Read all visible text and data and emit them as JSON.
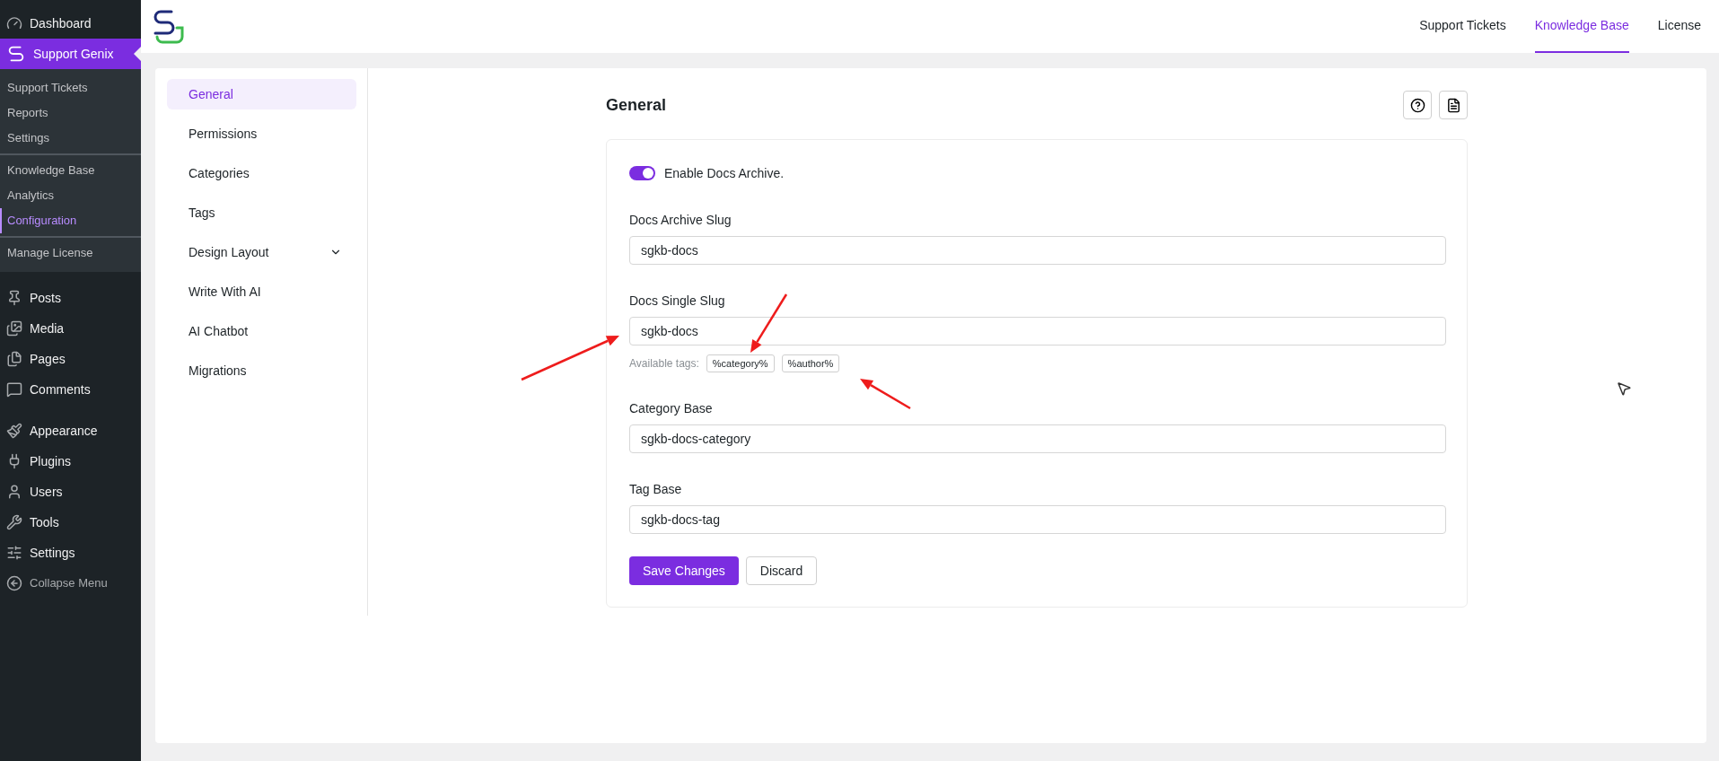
{
  "admin_menu": {
    "sections": [
      {
        "items": [
          {
            "label": "Dashboard",
            "selected": false
          },
          {
            "label": "Support Genix",
            "selected": true,
            "groups": [
              {
                "items": [
                  {
                    "label": "Support Tickets",
                    "selected": false
                  },
                  {
                    "label": "Reports",
                    "selected": false
                  },
                  {
                    "label": "Settings",
                    "selected": false
                  }
                ]
              },
              {
                "items": [
                  {
                    "label": "Knowledge Base",
                    "selected": false
                  },
                  {
                    "label": "Analytics",
                    "selected": false
                  },
                  {
                    "label": "Configuration",
                    "selected": true
                  }
                ]
              },
              {
                "items": [
                  {
                    "label": "Manage License",
                    "selected": false
                  }
                ]
              }
            ]
          }
        ]
      },
      {
        "items": [
          {
            "label": "Posts",
            "selected": false
          },
          {
            "label": "Media",
            "selected": false
          },
          {
            "label": "Pages",
            "selected": false
          },
          {
            "label": "Comments",
            "selected": false
          }
        ]
      },
      {
        "items": [
          {
            "label": "Appearance",
            "selected": false
          },
          {
            "label": "Plugins",
            "selected": false
          },
          {
            "label": "Users",
            "selected": false
          },
          {
            "label": "Tools",
            "selected": false
          },
          {
            "label": "Settings",
            "selected": false
          }
        ]
      }
    ],
    "collapse": "Collapse Menu"
  },
  "top_nav": [
    {
      "label": "Support Tickets",
      "selected": false
    },
    {
      "label": "Knowledge Base",
      "selected": true
    },
    {
      "label": "License",
      "selected": false
    }
  ],
  "settings_nav": [
    {
      "label": "General",
      "selected": true,
      "expandable": false
    },
    {
      "label": "Permissions",
      "selected": false,
      "expandable": false
    },
    {
      "label": "Categories",
      "selected": false,
      "expandable": false
    },
    {
      "label": "Tags",
      "selected": false,
      "expandable": false
    },
    {
      "label": "Design Layout",
      "selected": false,
      "expandable": true
    },
    {
      "label": "Write With AI",
      "selected": false,
      "expandable": false
    },
    {
      "label": "AI Chatbot",
      "selected": false,
      "expandable": false
    },
    {
      "label": "Migrations",
      "selected": false,
      "expandable": false
    }
  ],
  "section_title": "General",
  "toggle": {
    "label": "Enable Docs Archive.",
    "on": true
  },
  "fields": [
    {
      "label": "Docs Archive Slug",
      "value": "sgkb-docs"
    },
    {
      "label": "Docs Single Slug",
      "value": "sgkb-docs",
      "available_tags": {
        "label": "Available tags:",
        "tags": [
          "%category%",
          "%author%"
        ]
      }
    },
    {
      "label": "Category Base",
      "value": "sgkb-docs-category"
    },
    {
      "label": "Tag Base",
      "value": "sgkb-docs-tag"
    }
  ],
  "buttons": [
    {
      "label": "Save Changes",
      "kind": "primary"
    },
    {
      "label": "Discard",
      "kind": "secondary"
    }
  ]
}
